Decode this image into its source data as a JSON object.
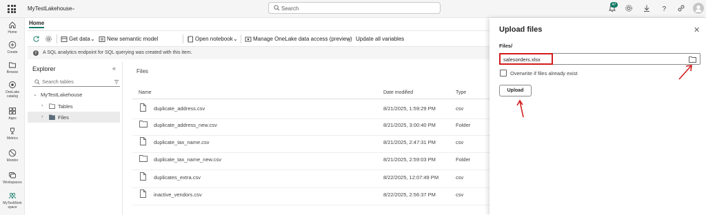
{
  "topbar": {
    "workspace_item": "MyTestLakehouse",
    "search_placeholder": "Search",
    "notification_count": "47"
  },
  "rail": {
    "items": [
      {
        "label": "Home"
      },
      {
        "label": "Create"
      },
      {
        "label": "Browse"
      },
      {
        "label": "OneLake catalog"
      },
      {
        "label": "Apps"
      },
      {
        "label": "Metrics"
      },
      {
        "label": "Monitor"
      },
      {
        "label": "Workspaces"
      },
      {
        "label": "MyTestWork space"
      }
    ]
  },
  "header": {
    "home_tab": "Home"
  },
  "ribbon": {
    "get_data": "Get data",
    "new_semantic_model": "New semantic model",
    "open_notebook": "Open notebook",
    "manage_onelake": "Manage OneLake data access (preview)",
    "update_vars": "Update all variables"
  },
  "info": {
    "message": "A SQL analytics endpoint for SQL querying was created with this item."
  },
  "explorer": {
    "title": "Explorer",
    "search_placeholder": "Search tables",
    "tree": [
      {
        "label": "MyTestLakehouse"
      },
      {
        "label": "Tables"
      },
      {
        "label": "Files"
      }
    ]
  },
  "files": {
    "title": "Files",
    "columns": {
      "name": "Name",
      "date": "Date modified",
      "type": "Type"
    },
    "rows": [
      {
        "name": "duplicate_address.csv",
        "date": "8/21/2025, 1:59:29 PM",
        "type": "csv",
        "icon": "file-icon"
      },
      {
        "name": "duplicate_address_new.csv",
        "date": "8/21/2025, 3:00:40 PM",
        "type": "Folder",
        "icon": "folder-icon"
      },
      {
        "name": "duplicate_tax_name.csv",
        "date": "8/21/2025, 2:47:31 PM",
        "type": "csv",
        "icon": "file-icon"
      },
      {
        "name": "duplicate_tax_name_new.csv",
        "date": "8/21/2025, 2:59:03 PM",
        "type": "Folder",
        "icon": "folder-icon"
      },
      {
        "name": "duplicates_extra.csv",
        "date": "8/22/2025, 12:07:49 PM",
        "type": "csv",
        "icon": "file-icon"
      },
      {
        "name": "inactive_vendors.csv",
        "date": "8/22/2025, 2:56:37 PM",
        "type": "csv",
        "icon": "file-icon"
      }
    ]
  },
  "upload_panel": {
    "title": "Upload files",
    "files_label": "Files/",
    "file_value": "salesorders.xlsx",
    "overwrite_label": "Overwrite if files already exist",
    "overwrite_checked": false,
    "upload_button": "Upload"
  },
  "colors": {
    "accent": "#117865",
    "highlight": "#d11a1a"
  }
}
